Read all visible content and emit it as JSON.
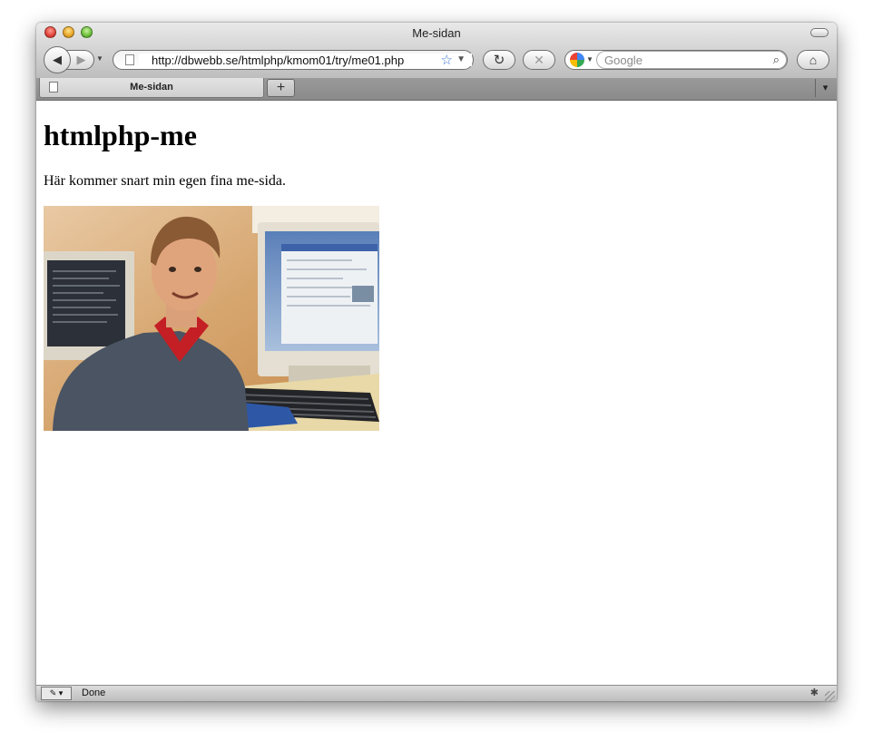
{
  "window": {
    "title": "Me-sidan"
  },
  "toolbar": {
    "back_glyph": "◀",
    "forward_glyph": "▶",
    "history_dropdown": "▼",
    "url": "http://dbwebb.se/htmlphp/kmom01/try/me01.php",
    "bookmark_glyph": "☆",
    "url_dropdown": "▼",
    "reload_glyph": "↻",
    "stop_glyph": "✕",
    "search_placeholder": "Google",
    "search_engine_dropdown": "▼",
    "search_glyph": "⌕",
    "home_glyph": "⌂"
  },
  "tabs": {
    "items": [
      {
        "label": "Me-sidan"
      }
    ],
    "new_tab_label": "+",
    "tab_list_glyph": "▾"
  },
  "page": {
    "heading": "htmlphp-me",
    "paragraph": "Här kommer snart min egen fina me-sida."
  },
  "status": {
    "tool_glyph": "✎ ▾",
    "message": "Done",
    "bug_glyph": "✱"
  }
}
